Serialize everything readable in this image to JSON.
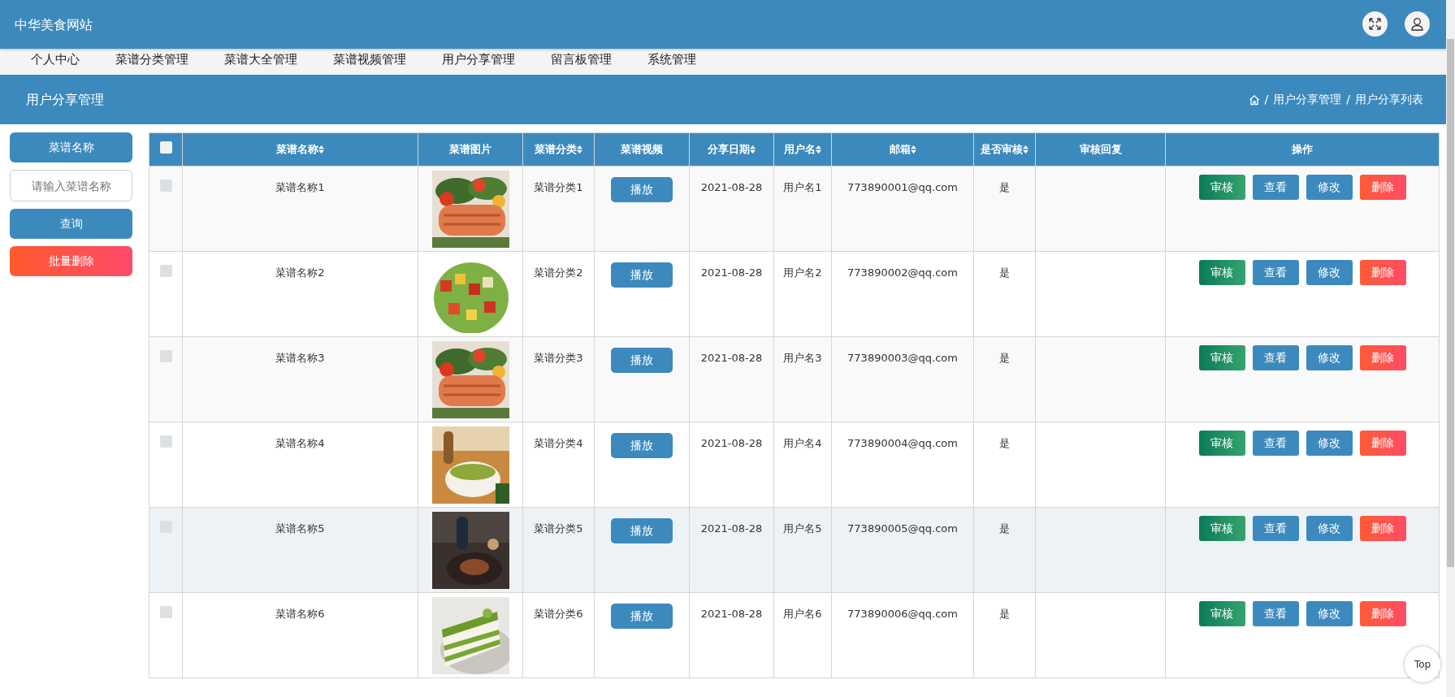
{
  "header": {
    "title": "中华美食网站"
  },
  "nav": [
    "个人中心",
    "菜谱分类管理",
    "菜谱大全管理",
    "菜谱视频管理",
    "用户分享管理",
    "留言板管理",
    "系统管理"
  ],
  "page": {
    "title": "用户分享管理",
    "breadcrumb": [
      "用户分享管理",
      "用户分享列表"
    ],
    "breadcrumb_separator": "/"
  },
  "sidebar": {
    "search": {
      "label": "菜谱名称",
      "placeholder": "请输入菜谱名称"
    },
    "buttons": [
      {
        "label": "查询",
        "kind": "query"
      },
      {
        "label": "批量删除",
        "kind": "danger"
      }
    ]
  },
  "table": {
    "select_all": {
      "checked": false
    },
    "columns": [
      {
        "label": "菜谱名称",
        "sortable": true
      },
      {
        "label": "菜谱图片",
        "sortable": false
      },
      {
        "label": "菜谱分类",
        "sortable": true
      },
      {
        "label": "菜谱视频",
        "sortable": false
      },
      {
        "label": "分享日期",
        "sortable": true
      },
      {
        "label": "用户名",
        "sortable": true
      },
      {
        "label": "邮箱",
        "sortable": true
      },
      {
        "label": "是否审核",
        "sortable": true
      },
      {
        "label": "审核回复",
        "sortable": false
      },
      {
        "label": "操作",
        "sortable": false
      }
    ],
    "rows": [
      {
        "checked": false,
        "highlighted": false,
        "name": "菜谱名称1",
        "category": "菜谱分类1",
        "video_button": "播放",
        "date": "2021-08-28",
        "user": "用户名1",
        "email": "773890001@qq.com",
        "audited": "是",
        "actions": [
          {
            "label": "审核",
            "kind": "audit"
          },
          {
            "label": "查看",
            "kind": "view"
          },
          {
            "label": "修改",
            "kind": "edit"
          },
          {
            "label": "删除",
            "kind": "delete"
          }
        ]
      },
      {
        "checked": false,
        "highlighted": false,
        "name": "菜谱名称2",
        "category": "菜谱分类2",
        "video_button": "播放",
        "date": "2021-08-28",
        "user": "用户名2",
        "email": "773890002@qq.com",
        "audited": "是",
        "actions": [
          {
            "label": "审核",
            "kind": "audit"
          },
          {
            "label": "查看",
            "kind": "view"
          },
          {
            "label": "修改",
            "kind": "edit"
          },
          {
            "label": "删除",
            "kind": "delete"
          }
        ]
      },
      {
        "checked": false,
        "highlighted": false,
        "name": "菜谱名称3",
        "category": "菜谱分类3",
        "video_button": "播放",
        "date": "2021-08-28",
        "user": "用户名3",
        "email": "773890003@qq.com",
        "audited": "是",
        "actions": [
          {
            "label": "审核",
            "kind": "audit"
          },
          {
            "label": "查看",
            "kind": "view"
          },
          {
            "label": "修改",
            "kind": "edit"
          },
          {
            "label": "删除",
            "kind": "delete"
          }
        ]
      },
      {
        "checked": false,
        "highlighted": false,
        "name": "菜谱名称4",
        "category": "菜谱分类4",
        "video_button": "播放",
        "date": "2021-08-28",
        "user": "用户名4",
        "email": "773890004@qq.com",
        "audited": "是",
        "actions": [
          {
            "label": "审核",
            "kind": "audit"
          },
          {
            "label": "查看",
            "kind": "view"
          },
          {
            "label": "修改",
            "kind": "edit"
          },
          {
            "label": "删除",
            "kind": "delete"
          }
        ]
      },
      {
        "checked": false,
        "highlighted": true,
        "name": "菜谱名称5",
        "category": "菜谱分类5",
        "video_button": "播放",
        "date": "2021-08-28",
        "user": "用户名5",
        "email": "773890005@qq.com",
        "audited": "是",
        "actions": [
          {
            "label": "审核",
            "kind": "audit"
          },
          {
            "label": "查看",
            "kind": "view"
          },
          {
            "label": "修改",
            "kind": "edit"
          },
          {
            "label": "删除",
            "kind": "delete"
          }
        ]
      },
      {
        "checked": false,
        "highlighted": false,
        "name": "菜谱名称6",
        "category": "菜谱分类6",
        "video_button": "播放",
        "date": "2021-08-28",
        "user": "用户名6",
        "email": "773890006@qq.com",
        "audited": "是",
        "actions": [
          {
            "label": "审核",
            "kind": "audit"
          },
          {
            "label": "查看",
            "kind": "view"
          },
          {
            "label": "修改",
            "kind": "edit"
          },
          {
            "label": "删除",
            "kind": "delete"
          }
        ]
      }
    ]
  },
  "back_to_top": "Top"
}
